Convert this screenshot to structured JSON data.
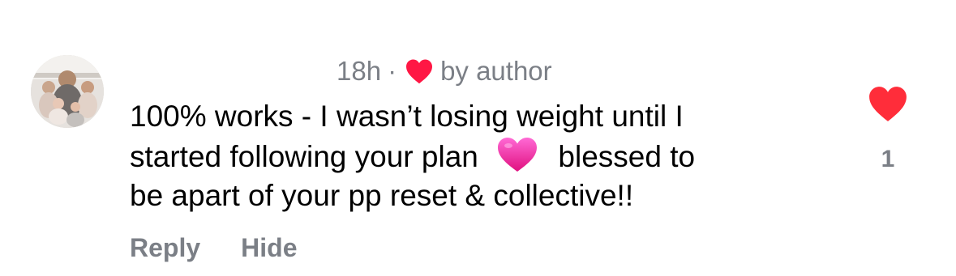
{
  "comment": {
    "avatar_icon": "user-avatar-photo",
    "meta": {
      "time": "18h",
      "separator": "·",
      "liked_by": "by author",
      "heart_icon": "red-heart-icon",
      "heart_color": "#ff1744"
    },
    "text_lines": [
      "100% works - I wasn’t losing weight until I",
      {
        "before": "started following your plan",
        "emoji_icon": "pink-heart-emoji",
        "after": "blessed to"
      },
      "be apart of your pp reset & collective!!"
    ],
    "actions": {
      "reply_label": "Reply",
      "hide_label": "Hide"
    },
    "like": {
      "icon": "heart-icon",
      "count": "1",
      "liked": true,
      "color": "#ff2d3a"
    }
  },
  "colors": {
    "secondary_text": "#7b7f86",
    "primary_text": "#000000",
    "pink_emoji": "#f0399f"
  }
}
